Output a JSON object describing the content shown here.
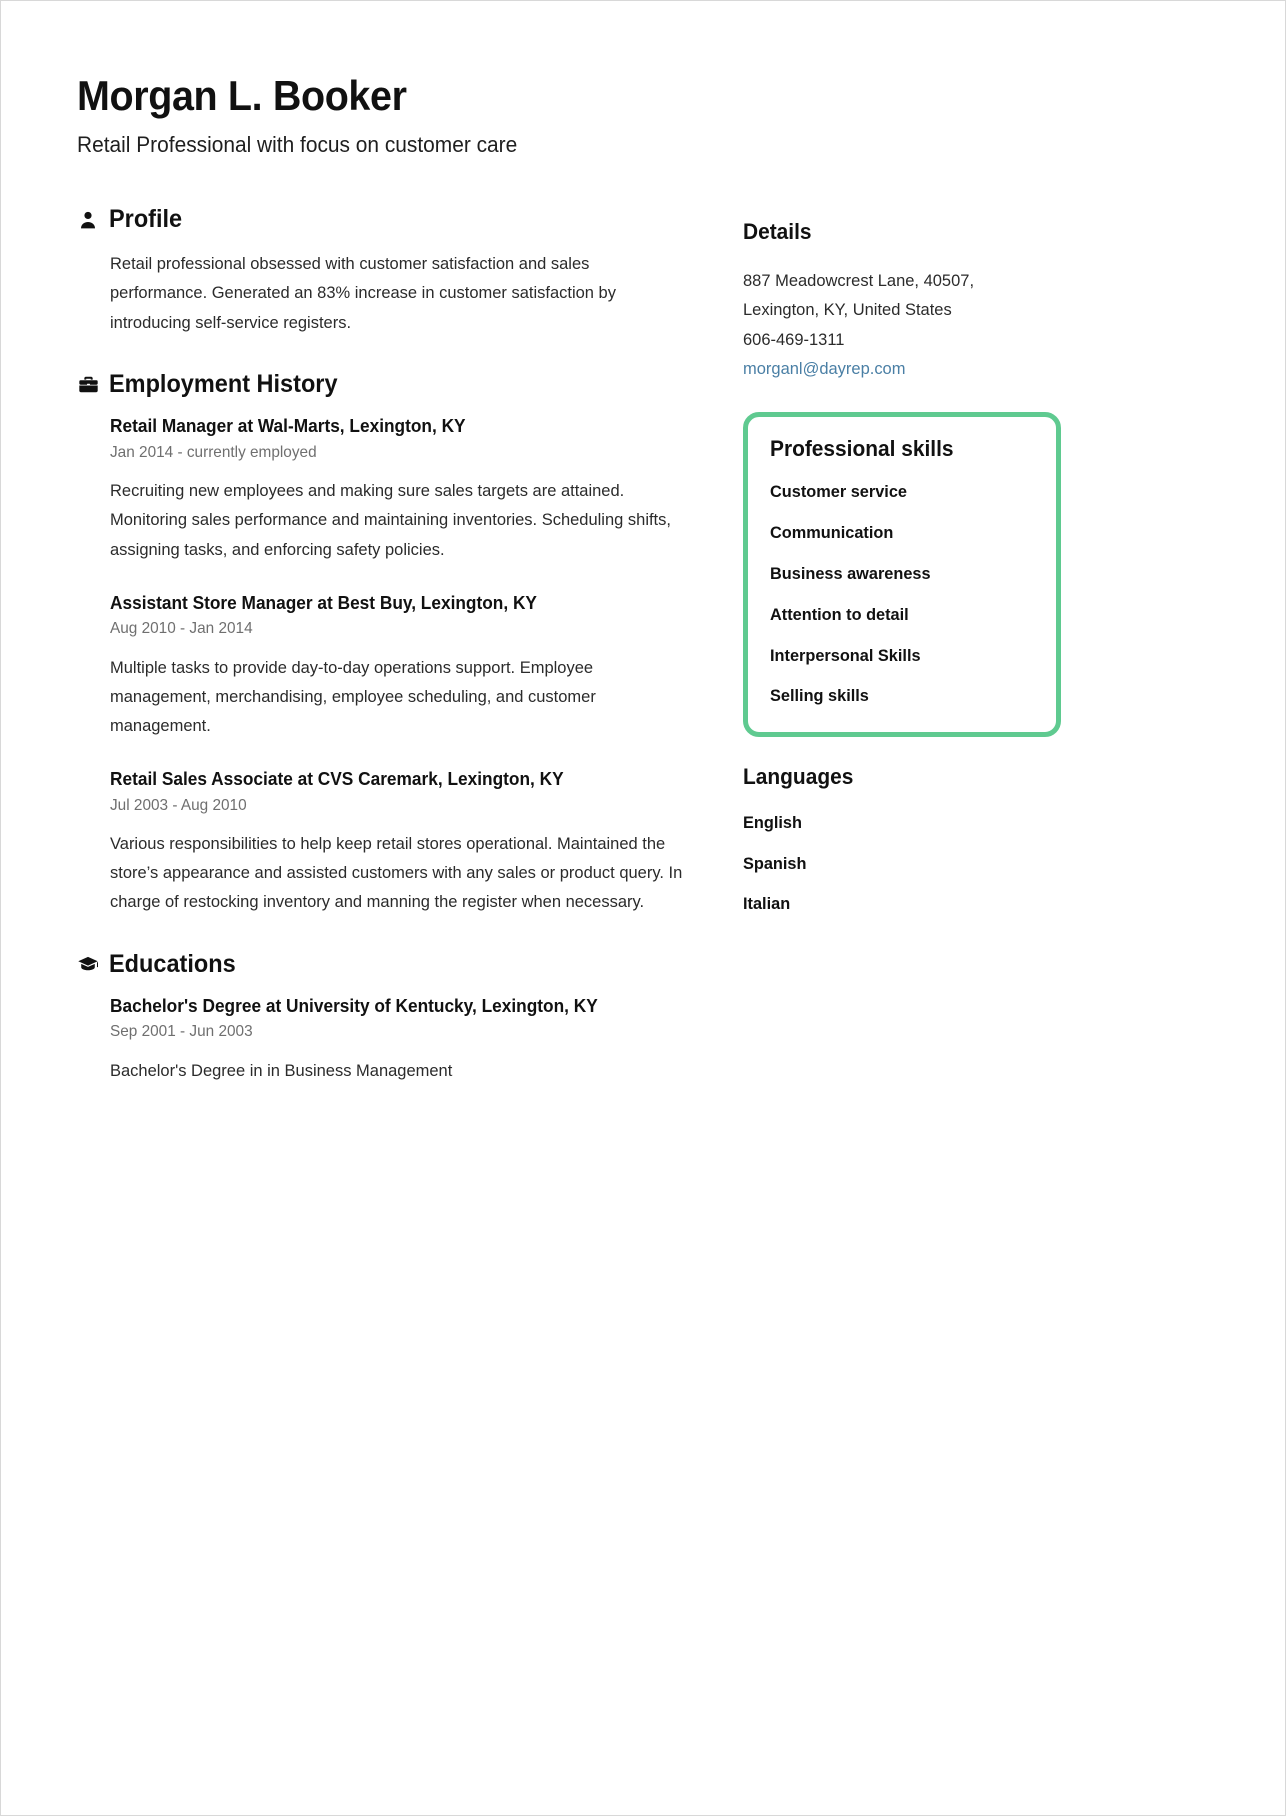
{
  "header": {
    "name": "Morgan L. Booker",
    "tagline": "Retail Professional with focus on customer care"
  },
  "profile": {
    "icon": "person-icon",
    "heading": "Profile",
    "text": "Retail professional obsessed with customer satisfaction and sales performance. Generated an 83% increase in customer satisfaction by introducing self-service registers."
  },
  "employment": {
    "icon": "briefcase-icon",
    "heading": "Employment History",
    "entries": [
      {
        "title": "Retail Manager at Wal-Marts, Lexington, KY",
        "dates": "Jan 2014 - currently employed",
        "description": "Recruiting new employees and making sure sales targets are attained. Monitoring sales performance and maintaining inventories. Scheduling shifts, assigning tasks, and enforcing safety policies."
      },
      {
        "title": "Assistant Store Manager at Best Buy, Lexington, KY",
        "dates": "Aug 2010 - Jan 2014",
        "description": "Multiple tasks to provide day-to-day operations support. Employee management, merchandising, employee scheduling, and customer management."
      },
      {
        "title": "Retail Sales Associate at CVS Caremark, Lexington, KY",
        "dates": "Jul 2003 - Aug 2010",
        "description": "Various responsibilities to help keep retail stores operational. Maintained the store’s appearance and assisted customers with any sales or product query. In charge of restocking inventory and manning the register when necessary."
      }
    ]
  },
  "educations": {
    "icon": "graduation-cap-icon",
    "heading": "Educations",
    "entries": [
      {
        "title": "Bachelor's Degree at University of Kentucky, Lexington, KY",
        "dates": "Sep 2001 - Jun 2003",
        "description": "Bachelor's Degree in in Business Management"
      }
    ]
  },
  "details": {
    "heading": "Details",
    "address_line1": "887 Meadowcrest Lane, 40507,",
    "address_line2": "Lexington, KY, United States",
    "phone": "606-469-1311",
    "email": "morganl@dayrep.com"
  },
  "skills": {
    "heading": "Professional skills",
    "accent_color": "#5fca90",
    "items": [
      "Customer service",
      "Communication",
      "Business awareness",
      "Attention to detail",
      "Interpersonal Skills",
      "Selling skills"
    ]
  },
  "languages": {
    "heading": "Languages",
    "items": [
      "English",
      "Spanish",
      "Italian"
    ]
  }
}
